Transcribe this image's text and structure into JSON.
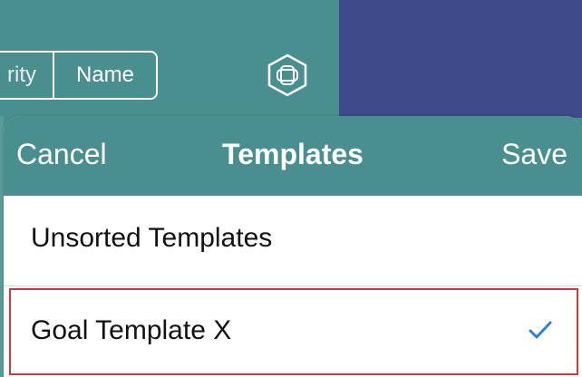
{
  "toolbar": {
    "segmented": {
      "priority_label": "rity",
      "name_label": "Name",
      "selected": "Name"
    },
    "add_icon": "add-template-hexagon-icon"
  },
  "popover": {
    "cancel_label": "Cancel",
    "title": "Templates",
    "save_label": "Save",
    "rows": [
      {
        "label": "Unsorted Templates",
        "checked": false
      },
      {
        "label": "Goal Template X",
        "checked": true
      }
    ]
  },
  "colors": {
    "teal": "#4a8f8f",
    "navy": "#3e4a8a",
    "check_blue": "#2f7fd8",
    "highlight_border": "#d03a3a"
  }
}
